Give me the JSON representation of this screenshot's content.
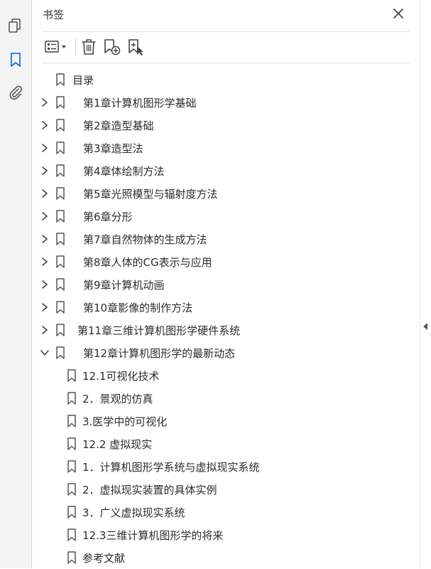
{
  "rail": {
    "items": [
      {
        "name": "pages-icon"
      },
      {
        "name": "bookmarks-icon",
        "active": true
      },
      {
        "name": "attachments-icon"
      }
    ]
  },
  "panel": {
    "title": "书签"
  },
  "toolbar": {
    "buttons": [
      {
        "name": "options-menu-button"
      },
      {
        "name": "delete-bookmark-button"
      },
      {
        "name": "new-bookmark-button"
      },
      {
        "name": "new-bookmark-from-structure-button"
      }
    ]
  },
  "bookmarks": [
    {
      "label": "目录",
      "level": 0,
      "chevron": "none"
    },
    {
      "label": "第1章计算机图形学基础",
      "level": 0,
      "chevron": "collapsed"
    },
    {
      "label": "第2章造型基础",
      "level": 0,
      "chevron": "collapsed"
    },
    {
      "label": "第3章造型法",
      "level": 0,
      "chevron": "collapsed"
    },
    {
      "label": "第4章体绘制方法",
      "level": 0,
      "chevron": "collapsed"
    },
    {
      "label": "第5章光照模型与辐射度方法",
      "level": 0,
      "chevron": "collapsed"
    },
    {
      "label": "第6章分形",
      "level": 0,
      "chevron": "collapsed"
    },
    {
      "label": "第7章自然物体的生成方法",
      "level": 0,
      "chevron": "collapsed"
    },
    {
      "label": "第8章人体的CG表示与应用",
      "level": 0,
      "chevron": "collapsed"
    },
    {
      "label": "第9章计算机动画",
      "level": 0,
      "chevron": "collapsed"
    },
    {
      "label": "第10章影像的制作方法",
      "level": 0,
      "chevron": "collapsed"
    },
    {
      "label": "第11章三维计算机图形学硬件系统",
      "level": 0,
      "chevron": "collapsed"
    },
    {
      "label": "第12章计算机图形学的最新动态",
      "level": 0,
      "chevron": "expanded"
    },
    {
      "label": "12.1可视化技术",
      "level": 1,
      "chevron": "none"
    },
    {
      "label": "2．景观的仿真",
      "level": 1,
      "chevron": "none"
    },
    {
      "label": "3.医学中的可视化",
      "level": 1,
      "chevron": "none"
    },
    {
      "label": "12.2  虚拟现实",
      "level": 1,
      "chevron": "none"
    },
    {
      "label": "1．计算机图形学系统与虚拟现实系统",
      "level": 1,
      "chevron": "none"
    },
    {
      "label": "2．虚拟现实装置的具体实例",
      "level": 1,
      "chevron": "none"
    },
    {
      "label": "3．广义虚拟现实系统",
      "level": 1,
      "chevron": "none"
    },
    {
      "label": "12.3三维计算机图形学的将来",
      "level": 1,
      "chevron": "none"
    },
    {
      "label": "参考文献",
      "level": 1,
      "chevron": "none"
    }
  ],
  "colors": {
    "accent": "#1473e6",
    "icon": "#555555",
    "text": "#2c2c2c"
  }
}
